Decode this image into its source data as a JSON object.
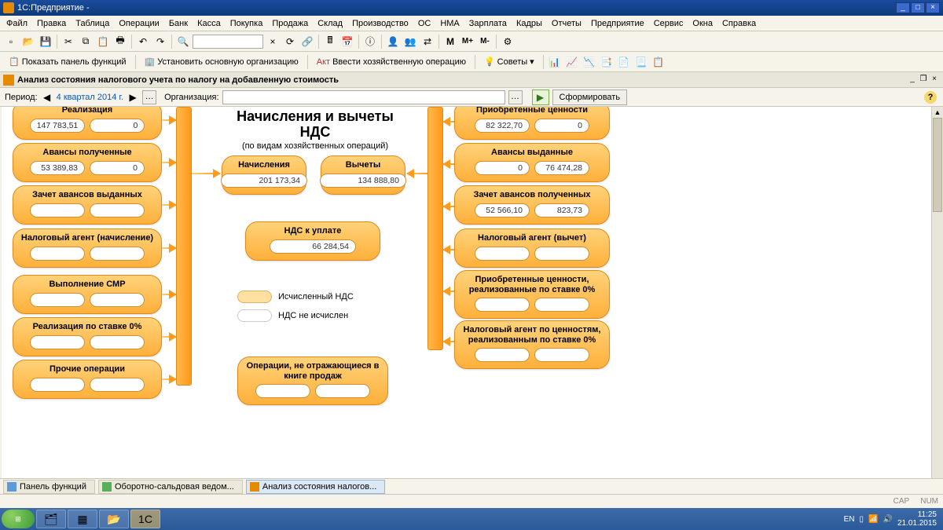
{
  "title": "1С:Предприятие -",
  "menu": [
    "Файл",
    "Правка",
    "Таблица",
    "Операции",
    "Банк",
    "Касса",
    "Покупка",
    "Продажа",
    "Склад",
    "Производство",
    "ОС",
    "НМА",
    "Зарплата",
    "Кадры",
    "Отчеты",
    "Предприятие",
    "Сервис",
    "Окна",
    "Справка"
  ],
  "toolbar2": {
    "panel_funcs": "Показать панель функций",
    "set_main_org": "Установить основную организацию",
    "enter_op": "Ввести хозяйственную операцию",
    "advices": "Советы"
  },
  "doctab": "Анализ состояния налогового учета по налогу на добавленную стоимость",
  "period": {
    "label": "Период:",
    "value": "4 квартал 2014 г."
  },
  "org_label": "Организация:",
  "form_btn": "Сформировать",
  "center": {
    "title1": "Начисления и вычеты",
    "title2": "НДС",
    "subtitle": "(по видам хозяйственных операций)"
  },
  "left_nodes": [
    {
      "title": "Реализация",
      "v1": "147 783,51",
      "v2": "0"
    },
    {
      "title": "Авансы полученные",
      "v1": "53 389,83",
      "v2": "0"
    },
    {
      "title": "Зачет авансов выданных",
      "v1": "",
      "v2": ""
    },
    {
      "title": "Налоговый агент (начисление)",
      "v1": "",
      "v2": ""
    },
    {
      "title": "Выполнение СМР",
      "v1": "",
      "v2": ""
    },
    {
      "title": "Реализация по ставке 0%",
      "v1": "",
      "v2": ""
    },
    {
      "title": "Прочие операции",
      "v1": "",
      "v2": ""
    }
  ],
  "right_nodes": [
    {
      "title": "Приобретенные ценности",
      "v1": "82 322,70",
      "v2": "0"
    },
    {
      "title": "Авансы выданные",
      "v1": "0",
      "v2": "76 474,28"
    },
    {
      "title": "Зачет авансов полученных",
      "v1": "52 566,10",
      "v2": "823,73"
    },
    {
      "title": "Налоговый агент (вычет)",
      "v1": "",
      "v2": ""
    },
    {
      "title": "Приобретенные ценности, реализованные по ставке 0%",
      "v1": "",
      "v2": ""
    },
    {
      "title": "Налоговый агент по ценностям, реализованным по ставке 0%",
      "v1": "",
      "v2": ""
    }
  ],
  "mid_nodes": {
    "charge": {
      "title": "Начисления",
      "val": "201 173,34"
    },
    "deduct": {
      "title": "Вычеты",
      "val": "134 888,80"
    },
    "payable": {
      "title": "НДС к уплате",
      "val": "66 284,54"
    },
    "book": {
      "title": "Операции, не отражающиеся в книге продаж",
      "v1": "",
      "v2": ""
    }
  },
  "legend": {
    "calc": "Исчисленный НДС",
    "nocalc": "НДС не исчислен"
  },
  "tabs": [
    "Панель функций",
    "Оборотно-сальдовая ведом...",
    "Анализ состояния налогов..."
  ],
  "status": {
    "cap": "CAP",
    "num": "NUM"
  },
  "tray": {
    "lang": "EN",
    "time": "11:25",
    "date": "21.01.2015"
  },
  "win_start": "Пуск"
}
